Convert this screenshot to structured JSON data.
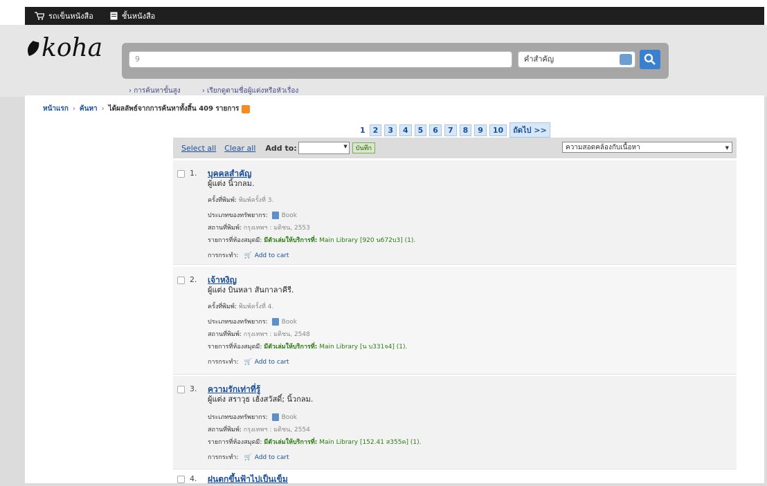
{
  "topbar": {
    "cart_label": "รถเข็นหนังสือ",
    "shelves_label": "ชั้นหนังสือ"
  },
  "logo": {
    "text": "koha"
  },
  "search": {
    "query": "9",
    "index_selected": "คำสำคัญ"
  },
  "sublinks": {
    "advanced": "การค้นหาขั้นสูง",
    "browse": "เรียกดูตามชื่อผู้แต่งหรือหัวเรื่อง"
  },
  "breadcrumb": {
    "home": "หน้าแรก",
    "search": "ค้นหา",
    "results": "ได้ผลลัพธ์จากการค้นหาทั้งสิ้น 409 รายการ"
  },
  "pager": {
    "current": "1",
    "pages": [
      "2",
      "3",
      "4",
      "5",
      "6",
      "7",
      "8",
      "9",
      "10"
    ],
    "next": "ถัดไป >>"
  },
  "toolbar": {
    "select_all": "Select all",
    "clear_all": "Clear all",
    "add_to": "Add to:",
    "save": "บันทึก",
    "sort": "ความสอดคล้องกับเนื้อหา"
  },
  "labels": {
    "edition": "ครั้งที่พิมพ์:",
    "type": "ประเภทของทรัพยากร:",
    "pub": "สถานที่พิมพ์:",
    "holdings": "รายการที่ห้องสมุดมี:",
    "available": "มีตัวเล่มให้บริการที่:",
    "actions": "การกระทำ:",
    "add_cart": "Add to cart"
  },
  "results": [
    {
      "num": "1.",
      "title": "บุคคลสำคัญ",
      "author": "ผู้แต่ง นิ้วกลม.",
      "edition": "พิมพ์ครั้งที่ 3.",
      "type": "Book",
      "pub": "กรุงเทพฯ : มติชน, 2553",
      "holdings": "Main Library [920 น672บ3] (1)."
    },
    {
      "num": "2.",
      "title": "เจ้าหงิญ",
      "author": "ผู้แต่ง บินหลา สันกาลาคีรี.",
      "edition": "พิมพ์ครั้งที่ 4.",
      "type": "Book",
      "pub": "กรุงเทพฯ : มติชน, 2548",
      "holdings": "Main Library [น บ331จ4] (1)."
    },
    {
      "num": "3.",
      "title": "ความรักเท่าที่รู้",
      "author": "ผู้แต่ง สราวุธ เฮ้งสวัสดิ์; นิ้วกลม.",
      "type": "Book",
      "pub": "กรุงเทพฯ : มติชน, 2554",
      "holdings": "Main Library [152.41 ส355ค] (1)."
    },
    {
      "num": "4.",
      "title": "ฝนตกขึ้นฟ้าไปเป็นเข็ม"
    }
  ],
  "colors": {
    "link": "#1a4f9c",
    "topbar": "#1f1f1f",
    "available": "#2a7a10"
  }
}
